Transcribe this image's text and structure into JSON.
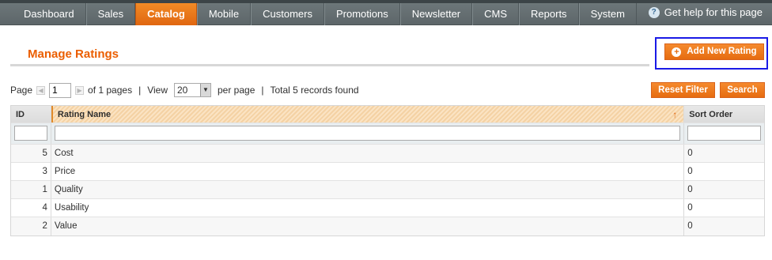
{
  "nav": {
    "items": [
      "Dashboard",
      "Sales",
      "Catalog",
      "Mobile",
      "Customers",
      "Promotions",
      "Newsletter",
      "CMS",
      "Reports",
      "System"
    ],
    "active": "Catalog",
    "help_label": "Get help for this page",
    "help_icon": "question-icon"
  },
  "header": {
    "title": "Manage Ratings",
    "add_button_label": "Add New Rating",
    "add_icon": "plus-circle-icon"
  },
  "pager": {
    "page_label": "Page",
    "page_value": "1",
    "of_pages": "of 1 pages",
    "sep1": "|",
    "view_label": "View",
    "per_page_value": "20",
    "per_page_label": "per page",
    "sep2": "|",
    "total_label": "Total 5 records found",
    "reset_filter_label": "Reset Filter",
    "search_label": "Search"
  },
  "grid": {
    "columns": [
      "ID",
      "Rating Name",
      "Sort Order"
    ],
    "sorted_column_icon": "arrow-up-icon",
    "rows": [
      {
        "id": "5",
        "name": "Cost",
        "sort": "0"
      },
      {
        "id": "3",
        "name": "Price",
        "sort": "0"
      },
      {
        "id": "1",
        "name": "Quality",
        "sort": "0"
      },
      {
        "id": "4",
        "name": "Usability",
        "sort": "0"
      },
      {
        "id": "2",
        "name": "Value",
        "sort": "0"
      }
    ]
  },
  "colors": {
    "accent": "#eb5e00",
    "nav_bg": "#636c6f",
    "highlight_border": "#1a1ae6"
  }
}
